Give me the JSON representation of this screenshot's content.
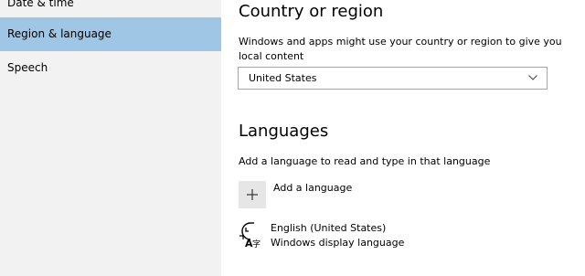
{
  "sidebar": {
    "items": [
      {
        "label": "Date & time"
      },
      {
        "label": "Region & language"
      },
      {
        "label": "Speech"
      }
    ]
  },
  "country": {
    "heading": "Country or region",
    "description": "Windows and apps might use your country or region to give you local content",
    "selected": "United States"
  },
  "languages": {
    "heading": "Languages",
    "description": "Add a language to read and type in that language",
    "add_label": "Add a language",
    "items": [
      {
        "name": "English (United States)",
        "subtitle": "Windows display language"
      }
    ]
  },
  "colors": {
    "sidebar_bg": "#f2f2f2",
    "sidebar_active": "#9fc6e5",
    "add_button_bg": "#e6e6e6"
  },
  "icons": [
    "chevron-down-icon",
    "plus-icon",
    "language-icon"
  ]
}
